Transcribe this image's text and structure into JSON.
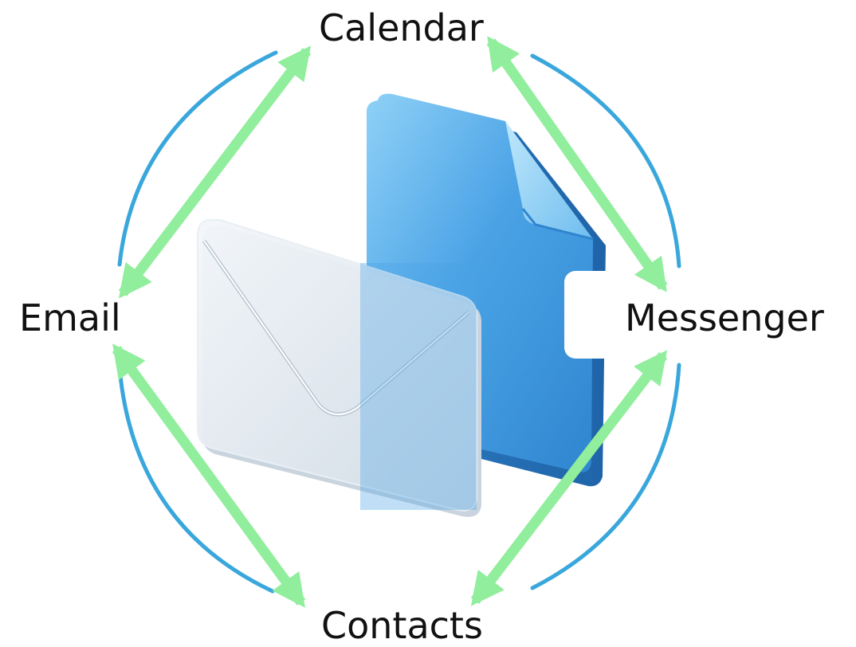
{
  "nodes": {
    "calendar": "Calendar",
    "email": "Email",
    "messenger": "Messenger",
    "contacts": "Contacts"
  },
  "colors": {
    "arc": "#3aa7dc",
    "arrow": "#90ee9c",
    "text": "#111111",
    "document": "#4ba3e6",
    "envelope": "#dfe8f0"
  },
  "icons": [
    "document-icon",
    "envelope-icon"
  ]
}
